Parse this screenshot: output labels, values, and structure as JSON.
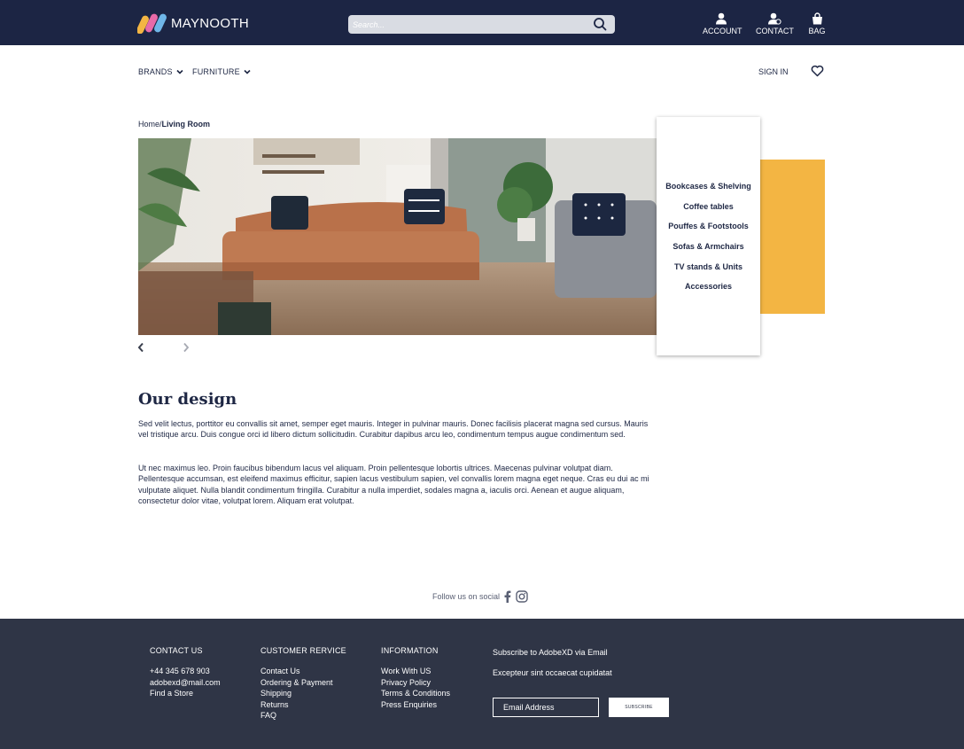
{
  "header": {
    "brand": "MAYNOOTH",
    "search": {
      "placeholder": "Search..."
    },
    "account_label": "ACCOUNT",
    "contact_label": "CONTACT",
    "bag_label": "BAG",
    "logo_colors": [
      "#f3b543",
      "#e86aa8",
      "#6fb6e8"
    ]
  },
  "nav": {
    "brands": "BRANDS",
    "furniture": "FURNITURE",
    "sign_in": "SIGN IN"
  },
  "breadcrumb": {
    "home": "Home/",
    "current": "Living Room"
  },
  "dropdown": {
    "items": [
      "Bookcases & Shelving",
      "Coffee tables",
      "Pouffes & Footstools",
      "Sofas & Armchairs",
      "TV stands & Units",
      "Accessories"
    ]
  },
  "content": {
    "title": "Our design",
    "paragraph1": "Sed velit lectus, porttitor eu convallis sit amet, semper eget mauris. Integer in pulvinar mauris. Donec facilisis placerat magna sed cursus. Mauris vel tristique arcu. Duis congue orci id libero dictum sollicitudin. Curabitur dapibus arcu leo, condimentum tempus augue condimentum sed.",
    "paragraph2": "Ut nec maximus leo. Proin faucibus bibendum lacus vel aliquam. Proin pellentesque lobortis ultrices. Maecenas pulvinar volutpat diam. Pellentesque accumsan, est eleifend maximus efficitur, sapien lacus vestibulum sapien, vel convallis lorem magna eget neque. Cras eu dui ac mi vulputate aliquet. Nulla blandit condimentum fringilla. Curabitur a nulla imperdiet, sodales magna a, iaculis orci. Aenean et augue aliquam, consectetur dolor vitae, volutpat lorem. Aliquam erat volutpat."
  },
  "social": {
    "label": "Follow us on social"
  },
  "footer": {
    "contact": {
      "title": "CONTACT US",
      "lines": [
        "+44 345 678 903",
        "adobexd@mail.com",
        "Find a Store"
      ]
    },
    "service": {
      "title": "CUSTOMER RERVICE",
      "lines": [
        "Contact Us",
        "Ordering & Payment",
        "Shipping",
        "Returns",
        "FAQ"
      ]
    },
    "info": {
      "title": "INFORMATION",
      "lines": [
        "Work With US",
        "Privacy Policy",
        "Terms & Conditions",
        "Press Enquiries"
      ]
    },
    "subscribe_title": "Subscribe to AdobeXD via Email",
    "subscribe_text": "Excepteur sint occaecat cupidatat",
    "email_placeholder": "Email Address",
    "subscribe_button": "SUBSCRIBE"
  }
}
